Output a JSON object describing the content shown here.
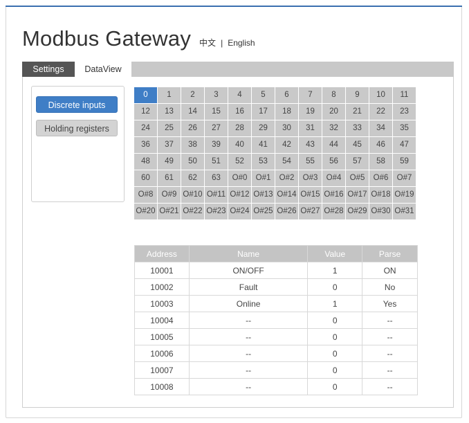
{
  "header": {
    "title": "Modbus Gateway",
    "lang_zh": "中文",
    "lang_sep": "|",
    "lang_en": "English"
  },
  "tabs": [
    {
      "label": "Settings",
      "active": false
    },
    {
      "label": "DataView",
      "active": true
    }
  ],
  "sidebar": {
    "discrete_inputs": "Discrete inputs",
    "holding_registers": "Holding registers"
  },
  "colors": {
    "accent": "#3f7ec6",
    "dark_tab": "#555555",
    "cell_bg": "#c9c9c9"
  },
  "grid": {
    "selected": "0",
    "cells": [
      "0",
      "1",
      "2",
      "3",
      "4",
      "5",
      "6",
      "7",
      "8",
      "9",
      "10",
      "11",
      "12",
      "13",
      "14",
      "15",
      "16",
      "17",
      "18",
      "19",
      "20",
      "21",
      "22",
      "23",
      "24",
      "25",
      "26",
      "27",
      "28",
      "29",
      "30",
      "31",
      "32",
      "33",
      "34",
      "35",
      "36",
      "37",
      "38",
      "39",
      "40",
      "41",
      "42",
      "43",
      "44",
      "45",
      "46",
      "47",
      "48",
      "49",
      "50",
      "51",
      "52",
      "53",
      "54",
      "55",
      "56",
      "57",
      "58",
      "59",
      "60",
      "61",
      "62",
      "63",
      "O#0",
      "O#1",
      "O#2",
      "O#3",
      "O#4",
      "O#5",
      "O#6",
      "O#7",
      "O#8",
      "O#9",
      "O#10",
      "O#11",
      "O#12",
      "O#13",
      "O#14",
      "O#15",
      "O#16",
      "O#17",
      "O#18",
      "O#19",
      "O#20",
      "O#21",
      "O#22",
      "O#23",
      "O#24",
      "O#25",
      "O#26",
      "O#27",
      "O#28",
      "O#29",
      "O#30",
      "O#31"
    ]
  },
  "table": {
    "headers": [
      "Address",
      "Name",
      "Value",
      "Parse"
    ],
    "rows": [
      [
        "10001",
        "ON/OFF",
        "1",
        "ON"
      ],
      [
        "10002",
        "Fault",
        "0",
        "No"
      ],
      [
        "10003",
        "Online",
        "1",
        "Yes"
      ],
      [
        "10004",
        "--",
        "0",
        "--"
      ],
      [
        "10005",
        "--",
        "0",
        "--"
      ],
      [
        "10006",
        "--",
        "0",
        "--"
      ],
      [
        "10007",
        "--",
        "0",
        "--"
      ],
      [
        "10008",
        "--",
        "0",
        "--"
      ]
    ]
  }
}
